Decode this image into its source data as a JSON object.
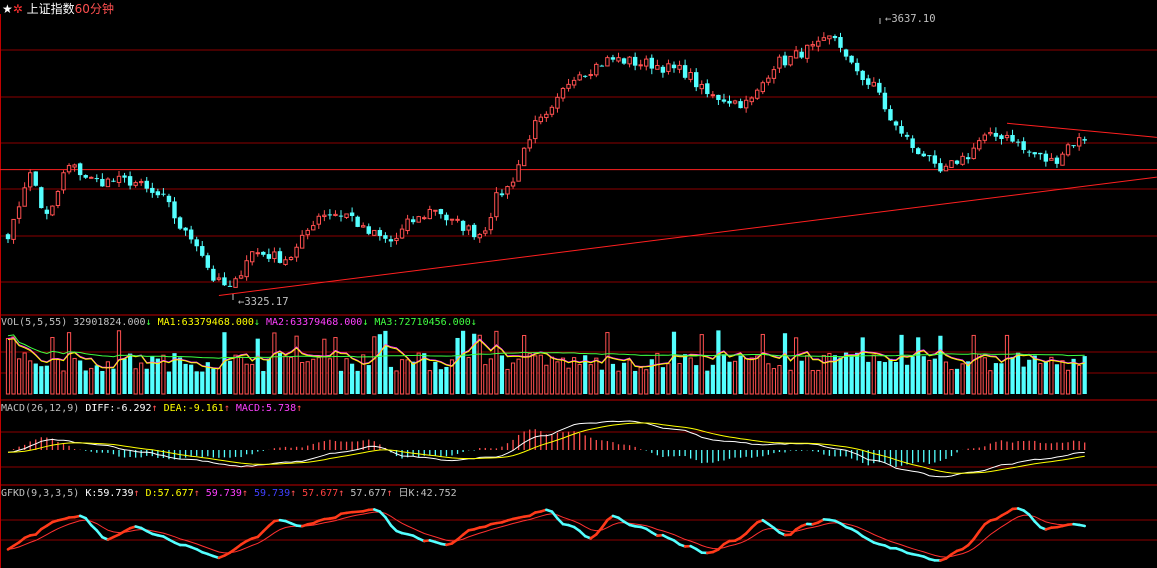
{
  "header": {
    "icons": [
      "star-icon",
      "gear-icon"
    ],
    "index_name": "上证指数",
    "period": "60分钟"
  },
  "colors": {
    "background": "#000000",
    "grid": "#8b0000",
    "up": "#ff5050",
    "down": "#54ffff",
    "trendline": "#ff2020",
    "ma1": "#ffff00",
    "ma2": "#ff40ff",
    "ma3": "#40ff40",
    "diff": "#ffffff",
    "dea": "#ffff00",
    "k": "#54ffff",
    "d": "#ff3030",
    "text": "#c0c0c0"
  },
  "annotations": {
    "high_label": "3637.10",
    "low_label": "3325.17"
  },
  "indicators": {
    "vol": {
      "name": "VOL(5,5,55)",
      "value": "32901824.000",
      "value_arrow": "↓",
      "ma1_label": "MA1:",
      "ma1_value": "63379468.000",
      "ma1_arrow": "↓",
      "ma2_label": "MA2:",
      "ma2_value": "63379468.000",
      "ma2_arrow": "↓",
      "ma3_label": "MA3:",
      "ma3_value": "72710456.000",
      "ma3_arrow": "↓"
    },
    "macd": {
      "name": "MACD(26,12,9)",
      "diff_label": "DIFF:",
      "diff_value": "-6.292",
      "diff_arrow": "↑",
      "dea_label": "DEA:",
      "dea_value": "-9.161",
      "dea_arrow": "↑",
      "macd_label": "MACD:",
      "macd_value": "5.738",
      "macd_arrow": "↑"
    },
    "gfkd": {
      "name": "GFKD(9,3,3,5)",
      "k_label": "K:",
      "k_value": "59.739",
      "k_arrow": "↑",
      "d_label": "D:",
      "d_value": "57.677",
      "d_arrow": "↑",
      "v3": "59.739",
      "v3_arrow": "↑",
      "v4": "59.739",
      "v4_arrow": "↑",
      "v5": "57.677",
      "v5_arrow": "↑",
      "v6": "57.677",
      "v6_arrow": "↑",
      "dayk_label": "日K:",
      "dayk_value": "42.752"
    }
  },
  "chart_data": [
    {
      "type": "candlestick",
      "title": "上证指数 60分钟",
      "ylim": [
        3300,
        3660
      ],
      "high_point": 3637.1,
      "low_point": 3325.17,
      "close_key_points": [
        [
          0,
          3395
        ],
        [
          4,
          3465
        ],
        [
          7,
          3415
        ],
        [
          11,
          3475
        ],
        [
          16,
          3458
        ],
        [
          22,
          3458
        ],
        [
          27,
          3440
        ],
        [
          33,
          3390
        ],
        [
          38,
          3335
        ],
        [
          40,
          3328
        ],
        [
          44,
          3372
        ],
        [
          50,
          3365
        ],
        [
          57,
          3420
        ],
        [
          61,
          3418
        ],
        [
          65,
          3395
        ],
        [
          69,
          3385
        ],
        [
          73,
          3410
        ],
        [
          77,
          3425
        ],
        [
          80,
          3408
        ],
        [
          85,
          3395
        ],
        [
          89,
          3445
        ],
        [
          96,
          3530
        ],
        [
          103,
          3590
        ],
        [
          109,
          3605
        ],
        [
          115,
          3600
        ],
        [
          121,
          3592
        ],
        [
          127,
          3560
        ],
        [
          133,
          3552
        ],
        [
          139,
          3602
        ],
        [
          145,
          3618
        ],
        [
          149,
          3632
        ],
        [
          152,
          3596
        ],
        [
          156,
          3572
        ],
        [
          160,
          3522
        ],
        [
          164,
          3495
        ],
        [
          168,
          3468
        ],
        [
          172,
          3486
        ],
        [
          176,
          3510
        ],
        [
          180,
          3514
        ],
        [
          184,
          3492
        ],
        [
          188,
          3482
        ],
        [
          192,
          3505
        ],
        [
          194,
          3510
        ]
      ],
      "trendlines": [
        {
          "from": [
            38,
            3320
          ],
          "to": [
            207,
            3463
          ]
        },
        {
          "from": [
            180,
            3528
          ],
          "to": [
            207,
            3511
          ]
        }
      ],
      "horizontal_line": 3472
    },
    {
      "type": "bar",
      "title": "VOL(5,5,55)",
      "series": [
        {
          "name": "VOL",
          "latest": 32901824.0
        },
        {
          "name": "MA1",
          "latest": 63379468.0
        },
        {
          "name": "MA2",
          "latest": 63379468.0
        },
        {
          "name": "MA3",
          "latest": 72710456.0
        }
      ]
    },
    {
      "type": "line",
      "title": "MACD(26,12,9)",
      "series": [
        {
          "name": "DIFF",
          "latest": -6.292
        },
        {
          "name": "DEA",
          "latest": -9.161
        },
        {
          "name": "MACD",
          "latest": 5.738
        }
      ],
      "diff_key_points": [
        [
          0,
          -5
        ],
        [
          8,
          22
        ],
        [
          16,
          12
        ],
        [
          24,
          -4
        ],
        [
          32,
          -20
        ],
        [
          42,
          -35
        ],
        [
          52,
          -25
        ],
        [
          60,
          -5
        ],
        [
          66,
          8
        ],
        [
          72,
          -14
        ],
        [
          80,
          -22
        ],
        [
          88,
          -14
        ],
        [
          96,
          30
        ],
        [
          104,
          58
        ],
        [
          112,
          62
        ],
        [
          120,
          45
        ],
        [
          128,
          20
        ],
        [
          136,
          12
        ],
        [
          144,
          14
        ],
        [
          150,
          2
        ],
        [
          156,
          -22
        ],
        [
          162,
          -44
        ],
        [
          168,
          -58
        ],
        [
          174,
          -48
        ],
        [
          180,
          -30
        ],
        [
          186,
          -20
        ],
        [
          194,
          -6
        ]
      ],
      "ylim": [
        -75,
        75
      ]
    },
    {
      "type": "line",
      "title": "GFKD(9,3,3,5)",
      "series": [
        {
          "name": "K",
          "latest": 59.739
        },
        {
          "name": "D",
          "latest": 57.677
        }
      ],
      "k_key_points": [
        [
          0,
          25
        ],
        [
          4,
          45
        ],
        [
          9,
          70
        ],
        [
          13,
          75
        ],
        [
          18,
          40
        ],
        [
          23,
          60
        ],
        [
          27,
          45
        ],
        [
          32,
          30
        ],
        [
          38,
          12
        ],
        [
          44,
          40
        ],
        [
          49,
          70
        ],
        [
          53,
          60
        ],
        [
          57,
          70
        ],
        [
          62,
          82
        ],
        [
          66,
          85
        ],
        [
          71,
          50
        ],
        [
          75,
          38
        ],
        [
          79,
          30
        ],
        [
          84,
          55
        ],
        [
          88,
          65
        ],
        [
          93,
          75
        ],
        [
          97,
          85
        ],
        [
          101,
          60
        ],
        [
          105,
          42
        ],
        [
          109,
          75
        ],
        [
          113,
          60
        ],
        [
          118,
          45
        ],
        [
          122,
          30
        ],
        [
          126,
          18
        ],
        [
          131,
          38
        ],
        [
          136,
          68
        ],
        [
          140,
          45
        ],
        [
          144,
          62
        ],
        [
          148,
          70
        ],
        [
          152,
          55
        ],
        [
          156,
          35
        ],
        [
          160,
          25
        ],
        [
          164,
          15
        ],
        [
          168,
          6
        ],
        [
          172,
          25
        ],
        [
          177,
          68
        ],
        [
          182,
          88
        ],
        [
          187,
          55
        ],
        [
          191,
          62
        ],
        [
          194,
          60
        ]
      ],
      "ylim": [
        0,
        100
      ]
    }
  ]
}
